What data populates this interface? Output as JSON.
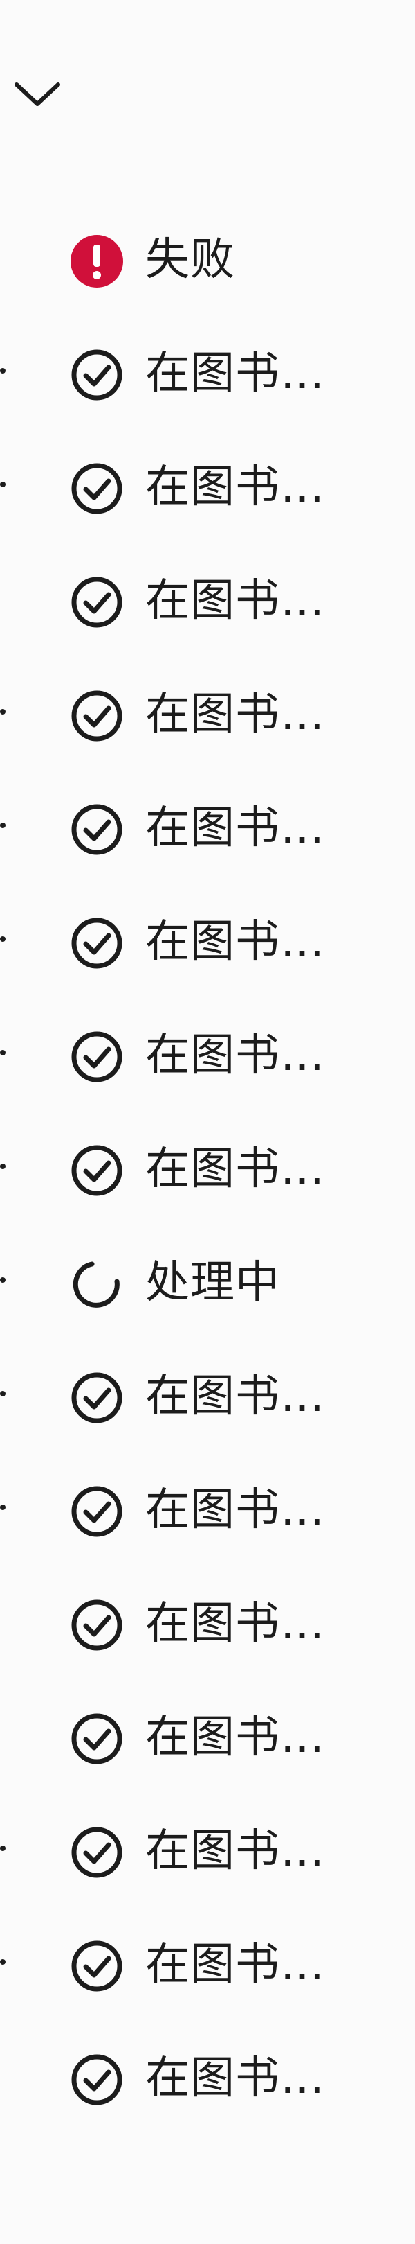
{
  "colors": {
    "error": "#d0103a",
    "text": "#1c1c1c"
  },
  "header": {
    "collapse_icon": "chevron-down-icon"
  },
  "rows": [
    {
      "status": "error",
      "icon": "error-icon",
      "label": "失败",
      "dot": false
    },
    {
      "status": "done",
      "icon": "check-circle-icon",
      "label": "在图书…",
      "dot": true
    },
    {
      "status": "done",
      "icon": "check-circle-icon",
      "label": "在图书…",
      "dot": true
    },
    {
      "status": "done",
      "icon": "check-circle-icon",
      "label": "在图书…",
      "dot": false
    },
    {
      "status": "done",
      "icon": "check-circle-icon",
      "label": "在图书…",
      "dot": true
    },
    {
      "status": "done",
      "icon": "check-circle-icon",
      "label": "在图书…",
      "dot": true
    },
    {
      "status": "done",
      "icon": "check-circle-icon",
      "label": "在图书…",
      "dot": true
    },
    {
      "status": "done",
      "icon": "check-circle-icon",
      "label": "在图书…",
      "dot": true
    },
    {
      "status": "done",
      "icon": "check-circle-icon",
      "label": "在图书…",
      "dot": true
    },
    {
      "status": "processing",
      "icon": "spinner-icon",
      "label": "处理中",
      "dot": true
    },
    {
      "status": "done",
      "icon": "check-circle-icon",
      "label": "在图书…",
      "dot": true
    },
    {
      "status": "done",
      "icon": "check-circle-icon",
      "label": "在图书…",
      "dot": true
    },
    {
      "status": "done",
      "icon": "check-circle-icon",
      "label": "在图书…",
      "dot": false
    },
    {
      "status": "done",
      "icon": "check-circle-icon",
      "label": "在图书…",
      "dot": false
    },
    {
      "status": "done",
      "icon": "check-circle-icon",
      "label": "在图书…",
      "dot": true
    },
    {
      "status": "done",
      "icon": "check-circle-icon",
      "label": "在图书…",
      "dot": true
    },
    {
      "status": "done",
      "icon": "check-circle-icon",
      "label": "在图书…",
      "dot": false
    }
  ]
}
